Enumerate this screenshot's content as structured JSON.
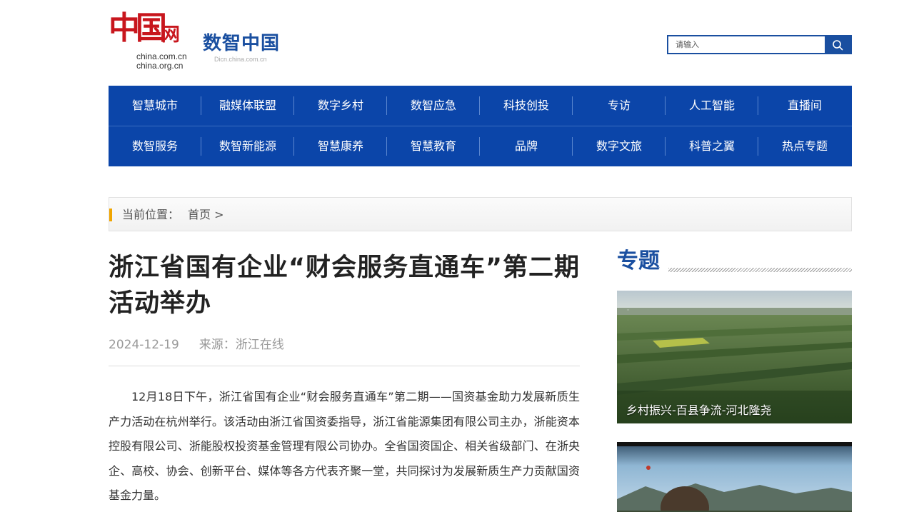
{
  "header": {
    "logo_domain_1": "china.com.cn",
    "logo_domain_2": "china.org.cn",
    "logo_text": "中国网",
    "site_title": "数智中国",
    "site_subtitle": "Dicn.china.com.cn",
    "search_placeholder": "请输入",
    "search_icon": "search-icon",
    "brand_color": "#0b45a9"
  },
  "nav": {
    "row1": [
      "智慧城市",
      "融媒体联盟",
      "数字乡村",
      "数智应急",
      "科技创投",
      "专访",
      "人工智能",
      "直播间"
    ],
    "row2": [
      "数智服务",
      "数智新能源",
      "智慧康养",
      "智慧教育",
      "品牌",
      "数字文旅",
      "科普之翼",
      "热点专题"
    ]
  },
  "breadcrumb": {
    "label": "当前位置：",
    "home": "首页",
    "separator": ">"
  },
  "article": {
    "title": "浙江省国有企业“财会服务直通车”第二期活动举办",
    "date": "2024-12-19",
    "source": "来源：浙江在线",
    "paragraph": "12月18日下午，浙江省国有企业“财会服务直通车”第二期——国资基金助力发展新质生产力活动在杭州举行。该活动由浙江省国资委指导，浙江省能源集团有限公司主办，浙能资本控股有限公司、浙能股权投资基金管理有限公司协办。全省国资国企、相关省级部门、在浙央企、高校、协会、创新平台、媒体等各方代表齐聚一堂，共同探讨为发展新质生产力贡献国资基金力量。"
  },
  "sidebar": {
    "heading": "专题",
    "cards": [
      {
        "caption": "乡村振兴-百县争流-河北隆尧"
      },
      {
        "caption": ""
      }
    ]
  }
}
